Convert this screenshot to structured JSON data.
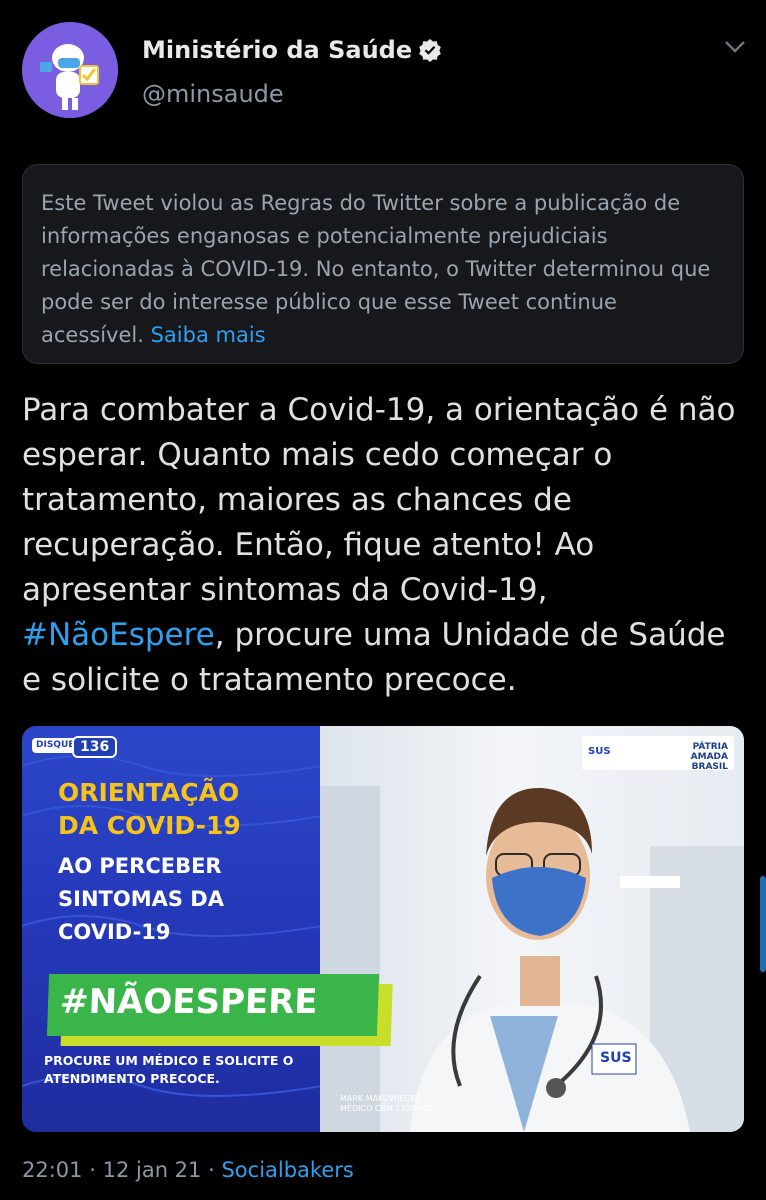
{
  "author": {
    "name": "Ministério da Saúde",
    "handle": "@minsaude"
  },
  "notice": {
    "text": "Este Tweet violou as Regras do Twitter sobre a publicação de informações enganosas e potencialmente prejudiciais relacionadas à COVID-19. No entanto, o Twitter determinou que pode ser do interesse público que esse Tweet continue acessível. ",
    "link": "Saiba mais"
  },
  "tweet": {
    "text_before": "Para combater a Covid-19, a orientação é não esperar. Quanto mais cedo começar o tratamento, maiores as chances de recuperação. Então, fique atento! Ao apresentar sintomas da Covid-19, ",
    "hashtag": "#NãoEspere",
    "text_after": ", procure uma Unidade de Saúde e solicite o tratamento precoce."
  },
  "media": {
    "disque_label": "DISQUE SAÚDE",
    "disque_number": "136",
    "title": "ORIENTAÇÃO DA COVID-19",
    "subtitle": "AO PERCEBER SINTOMAS DA COVID-19",
    "tag": "#NÃOESPERE",
    "footer": "PROCURE UM MÉDICO E SOLICITE O ATENDIMENTO PRECOCE.",
    "logo_sus": "SUS",
    "logo_brasil": "PÁTRIA AMADA BRASIL",
    "doctor_name": "MARK MAKOWIECKY",
    "doctor_crm": "MÉDICO CRM 17394/DF",
    "coat_label": "SUS"
  },
  "meta": {
    "time": "22:01",
    "date": "12 jan 21",
    "source": "Socialbakers"
  },
  "colors": {
    "link": "#2ea0f0",
    "media_blue": "#2438b8",
    "title_yellow": "#f6c21c",
    "tag_green": "#39b54a"
  }
}
